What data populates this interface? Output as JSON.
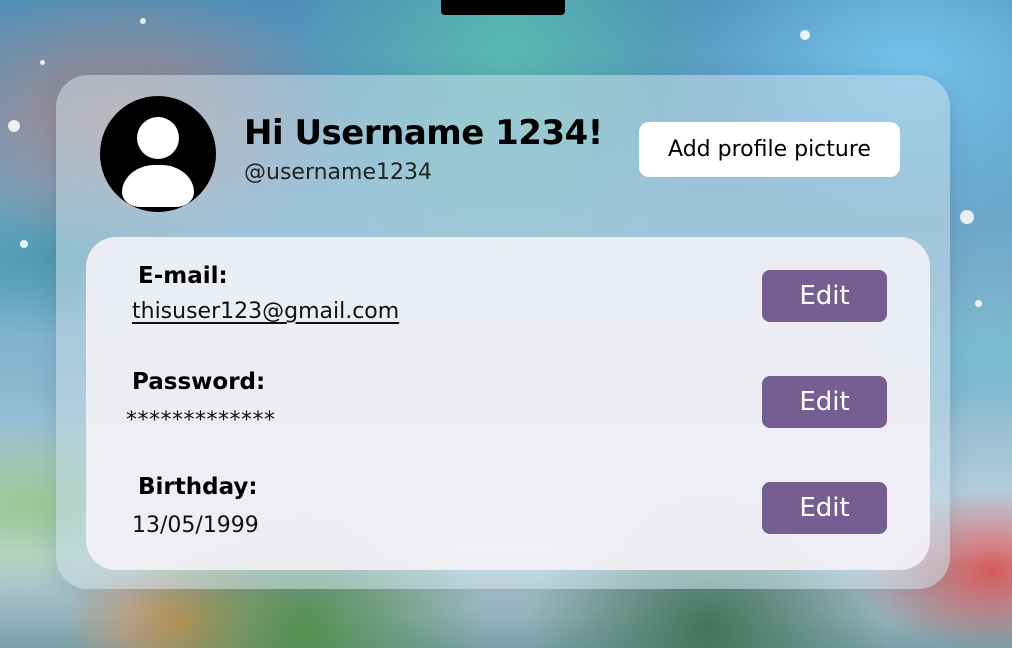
{
  "header": {
    "greeting": "Hi Username 1234!",
    "handle": "@username1234",
    "add_picture_label": "Add profile picture",
    "avatar_icon": "user-avatar-icon"
  },
  "fields": {
    "email": {
      "label": "E-mail:",
      "value": "thisuser123@gmail.com",
      "edit_label": "Edit"
    },
    "password": {
      "label": "Password:",
      "value": "*************",
      "edit_label": "Edit"
    },
    "birthday": {
      "label": "Birthday:",
      "value": "13/05/1999",
      "edit_label": "Edit"
    }
  },
  "colors": {
    "edit_button": "#775e92",
    "card": "rgba(200,220,232,0.55)",
    "panel": "rgba(245,243,247,0.88)"
  }
}
